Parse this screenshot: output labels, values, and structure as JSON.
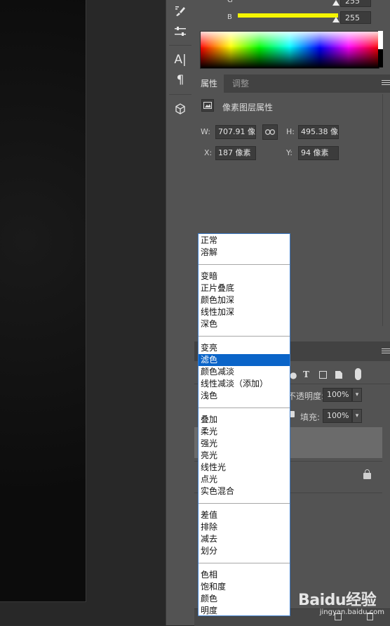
{
  "color_panel": {
    "channel_g_label": "G",
    "channel_g_value": "255",
    "channel_b_label": "B",
    "channel_b_value": "255",
    "channel_b_color": "#f5f500"
  },
  "properties_panel": {
    "tab_properties": "属性",
    "tab_adjustments": "调整",
    "title": "像素图层属性",
    "w_label": "W:",
    "w_value": "707.91 像素",
    "h_label": "H:",
    "h_value": "495.38 像素",
    "x_label": "X:",
    "x_value": "187 像素",
    "y_label": "Y:",
    "y_value": "94 像素"
  },
  "layers_panel": {
    "opacity_label": "不透明度:",
    "opacity_value": "100%",
    "fill_label": "填充:",
    "fill_value": "100%"
  },
  "blend_menu": {
    "selected": "滤色",
    "groups": [
      [
        "正常",
        "溶解"
      ],
      [
        "变暗",
        "正片叠底",
        "颜色加深",
        "线性加深",
        "深色"
      ],
      [
        "变亮",
        "滤色",
        "颜色减淡",
        "线性减淡（添加）",
        "浅色"
      ],
      [
        "叠加",
        "柔光",
        "强光",
        "亮光",
        "线性光",
        "点光",
        "实色混合"
      ],
      [
        "差值",
        "排除",
        "减去",
        "划分"
      ],
      [
        "色相",
        "饱和度",
        "颜色",
        "明度"
      ]
    ]
  },
  "watermark": {
    "brand": "Baidu经验",
    "sub": "jingyan.baidu.com"
  },
  "icons": {
    "tools": [
      "brush-icon",
      "adjust-sliders-icon",
      "type-icon",
      "paragraph-icon",
      "3d-cube-icon"
    ],
    "layer_filters": [
      "type-filter-icon",
      "transform-filter-icon",
      "smart-object-filter-icon",
      "toggle-filter-icon"
    ]
  }
}
